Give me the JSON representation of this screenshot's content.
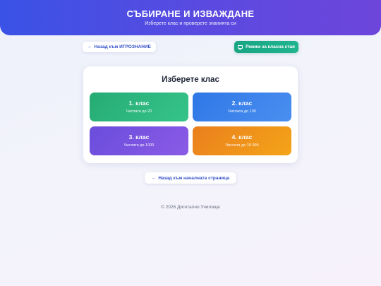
{
  "header": {
    "title": "СЪБИРАНЕ И ИЗВАЖДАНЕ",
    "subtitle": "Изберете клас и проверете знанията си"
  },
  "nav": {
    "back_icon": "←",
    "back_games_label": "Назад към ИГРОЗНАНИЕ",
    "classroom_icon": "monitor-icon",
    "classroom_mode_label": "Режим за класна стая"
  },
  "card": {
    "title": "Изберете клас",
    "grades": [
      {
        "name": "1. клас",
        "desc": "Числата до 20",
        "color": "#2fb67f"
      },
      {
        "name": "2. клас",
        "desc": "Числата до 100",
        "color": "#3d85ec"
      },
      {
        "name": "3. клас",
        "desc": "Числата до 1000",
        "color": "#7a55e1"
      },
      {
        "name": "4. клас",
        "desc": "Числата до 10 000",
        "color": "#f09a1b"
      }
    ]
  },
  "footer": {
    "back_home_label": "Назад към началната страница",
    "copyright": "© 2026 Дигитално Училище"
  }
}
